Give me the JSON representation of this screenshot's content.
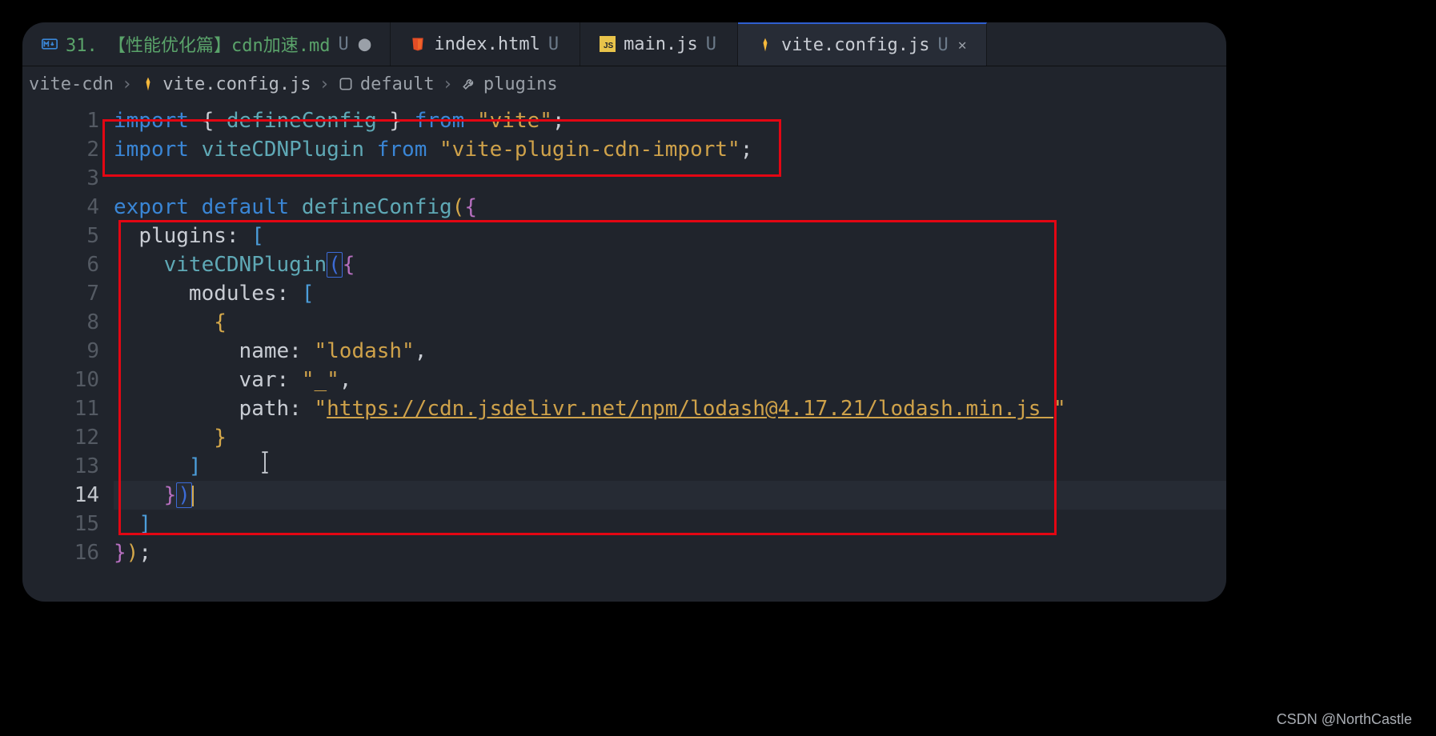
{
  "tabs": [
    {
      "icon": "markdown",
      "label": "31. 【性能优化篇】cdn加速.md",
      "status": "U",
      "dirty": true,
      "active": false
    },
    {
      "icon": "html",
      "label": "index.html",
      "status": "U",
      "dirty": false,
      "active": false
    },
    {
      "icon": "js",
      "label": "main.js",
      "status": "U",
      "dirty": false,
      "active": false
    },
    {
      "icon": "vite",
      "label": "vite.config.js",
      "status": "U",
      "dirty": false,
      "active": true,
      "closeable": true
    }
  ],
  "breadcrumb": {
    "root": "vite-cdn",
    "file": "vite.config.js",
    "sym1": "default",
    "sym2": "plugins"
  },
  "code": {
    "l1": {
      "a": "import",
      "b": " { ",
      "c": "defineConfig",
      "d": " } ",
      "e": "from",
      "f": " ",
      "g": "\"vite\"",
      "h": ";"
    },
    "l2": {
      "a": "import",
      "b": " ",
      "c": "viteCDNPlugin",
      "d": " ",
      "e": "from",
      "f": " ",
      "g": "\"vite-plugin-cdn-import\"",
      "h": ";"
    },
    "l3": "",
    "l4": {
      "a": "export",
      "b": " ",
      "c": "default",
      "d": " ",
      "e": "defineConfig",
      "f": "(",
      "g": "{"
    },
    "l5": {
      "indent": "  ",
      "a": "plugins",
      "b": ": ",
      "c": "["
    },
    "l6": {
      "indent": "    ",
      "a": "viteCDNPlugin",
      "b": "(",
      "c": "{"
    },
    "l7": {
      "indent": "      ",
      "a": "modules",
      "b": ": ",
      "c": "["
    },
    "l8": {
      "indent": "        ",
      "a": "{"
    },
    "l9": {
      "indent": "          ",
      "a": "name",
      "b": ": ",
      "c": "\"lodash\"",
      "d": ","
    },
    "l10": {
      "indent": "          ",
      "a": "var",
      "b": ": ",
      "c": "\"_\"",
      "d": ","
    },
    "l11": {
      "indent": "          ",
      "a": "path",
      "b": ": ",
      "c": "\"",
      "d": "https://cdn.jsdelivr.net/npm/lodash@4.17.21/lodash.min.js ",
      "e": "\""
    },
    "l12": {
      "indent": "        ",
      "a": "}"
    },
    "l13": {
      "indent": "      ",
      "a": "]"
    },
    "l14": {
      "indent": "    ",
      "a": "}",
      "b": ")"
    },
    "l15": {
      "indent": "  ",
      "a": "]"
    },
    "l16": {
      "a": "}",
      "b": ")",
      "c": ";"
    }
  },
  "watermark": "CSDN @NorthCastle"
}
